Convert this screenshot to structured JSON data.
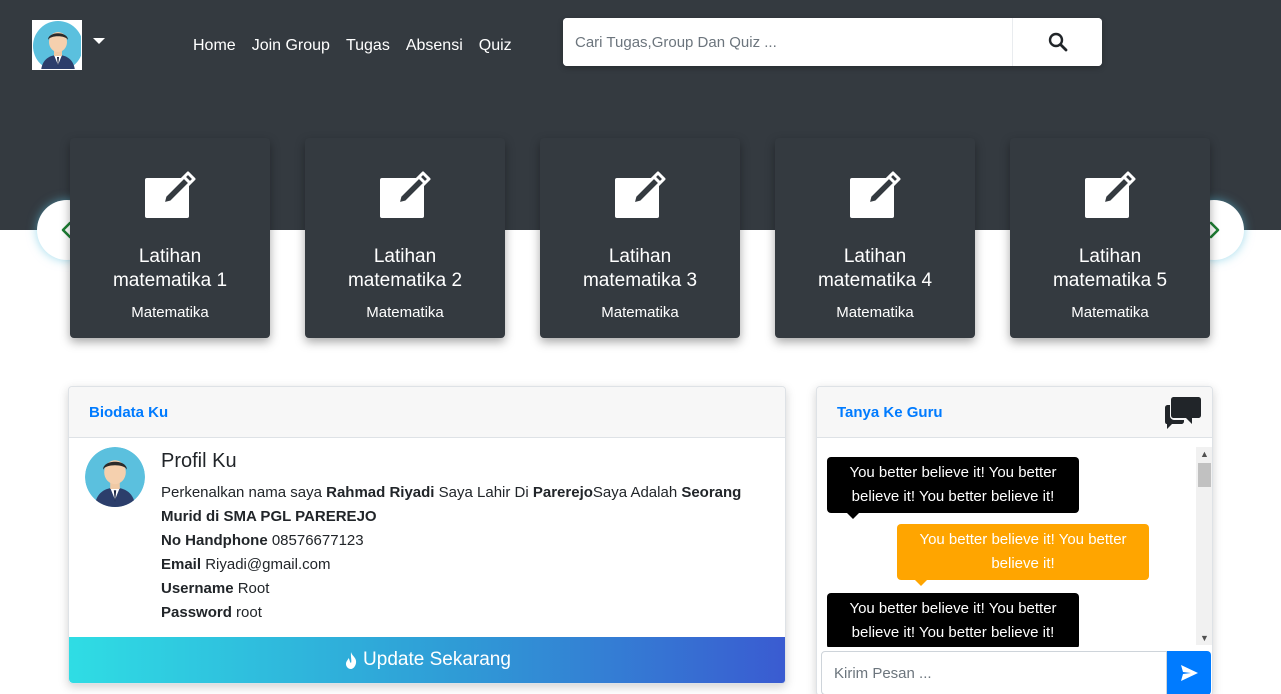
{
  "nav": {
    "links": [
      "Home",
      "Join Group",
      "Tugas",
      "Absensi",
      "Quiz"
    ]
  },
  "search": {
    "placeholder": "Cari Tugas,Group Dan Quiz ..."
  },
  "cards": [
    {
      "title_line1": "Latihan",
      "title_line2": "matematika 1",
      "subject": "Matematika"
    },
    {
      "title_line1": "Latihan",
      "title_line2": "matematika 2",
      "subject": "Matematika"
    },
    {
      "title_line1": "Latihan",
      "title_line2": "matematika 3",
      "subject": "Matematika"
    },
    {
      "title_line1": "Latihan",
      "title_line2": "matematika 4",
      "subject": "Matematika"
    },
    {
      "title_line1": "Latihan",
      "title_line2": "matematika 5",
      "subject": "Matematika"
    }
  ],
  "biodata": {
    "header": "Biodata Ku",
    "profile_title": "Profil Ku",
    "intro_prefix": "Perkenalkan nama saya ",
    "name": "Rahmad Riyadi",
    "born_text": " Saya Lahir Di ",
    "birthplace": "Parerejo",
    "role_text": "Saya Adalah ",
    "role": "Seorang Murid di SMA PGL PAREREJO",
    "phone_label": "No Handphone",
    "phone": "08576677123",
    "email_label": "Email",
    "email": "Riyadi@gmail.com",
    "username_label": "Username",
    "username": "Root",
    "password_label": "Password",
    "password": "root",
    "update_label": "Update Sekarang"
  },
  "chat": {
    "header": "Tanya Ke Guru",
    "messages": [
      {
        "line1": "You better believe it! You better",
        "line2": "believe it! You better believe it!",
        "style": "dark"
      },
      {
        "line1": "You better believe it! You better",
        "line2": "believe it!",
        "style": "orange"
      },
      {
        "line1": "You better believe it! You better",
        "line2": "believe it! You better believe it!",
        "style": "dark"
      }
    ],
    "input_placeholder": "Kirim Pesan ..."
  },
  "colors": {
    "dark_bg": "#343a40",
    "primary": "#007bff",
    "orange": "#ffa500",
    "slider_arrow": "#1e7e34"
  },
  "icons": {
    "search": "search-icon",
    "edit": "edit-icon",
    "chat": "comments-icon",
    "send": "send-icon",
    "fire": "fire-icon"
  }
}
